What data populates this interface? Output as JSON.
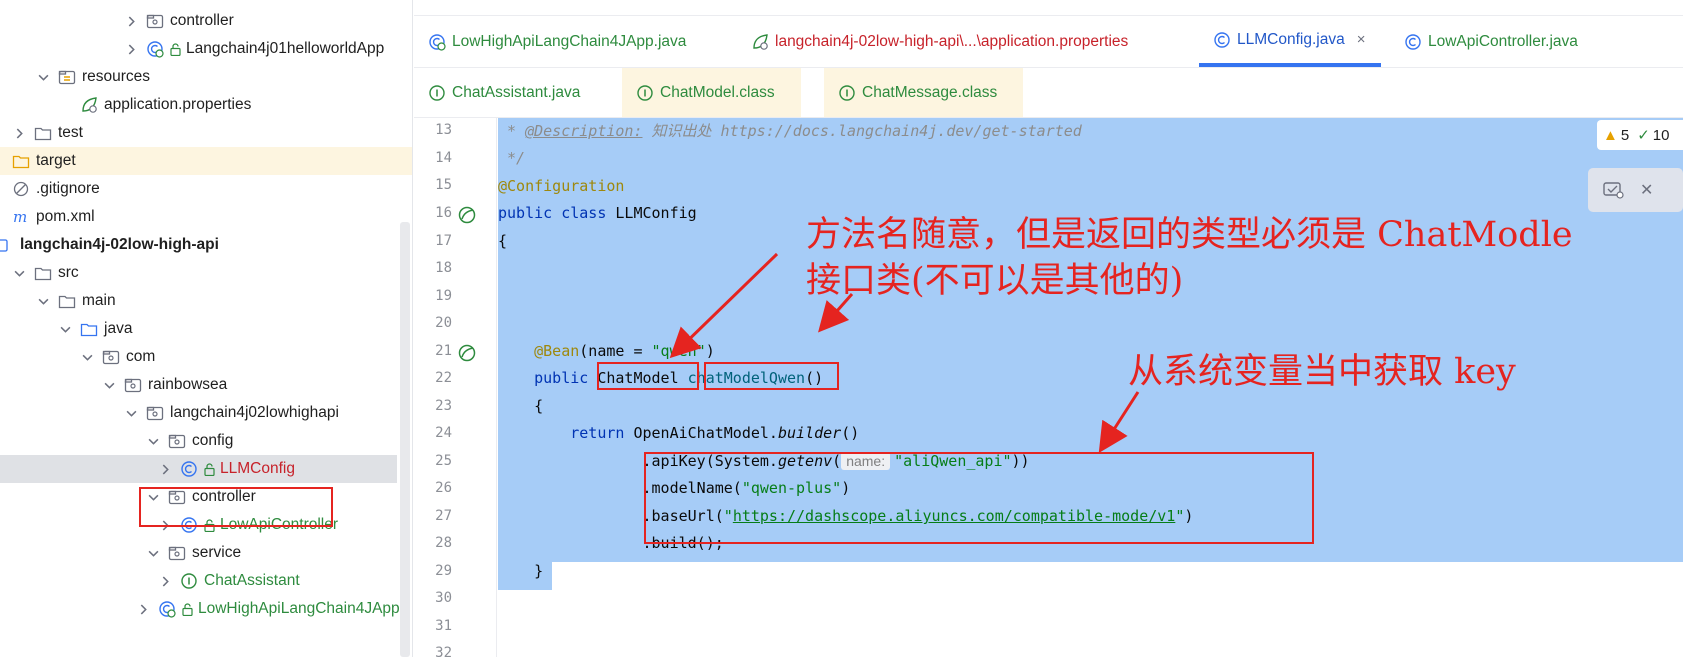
{
  "tree": {
    "items": [
      {
        "label": "controller",
        "icon": "package-folder-icon"
      },
      {
        "label": "Langchain4j01helloworldApp",
        "icon": "springboot-class-icon"
      },
      {
        "label": "resources",
        "icon": "resources-folder-icon"
      },
      {
        "label": "application.properties",
        "icon": "spring-properties-icon"
      },
      {
        "label": "test",
        "icon": "folder-icon"
      },
      {
        "label": "target",
        "icon": "excluded-folder-icon"
      },
      {
        "label": ".gitignore",
        "icon": "gitignore-icon"
      },
      {
        "label": "pom.xml",
        "icon": "maven-icon"
      },
      {
        "label": "langchain4j-02low-high-api",
        "icon": "module-icon"
      },
      {
        "label": "src",
        "icon": "folder-icon"
      },
      {
        "label": "main",
        "icon": "folder-icon"
      },
      {
        "label": "java",
        "icon": "source-folder-icon"
      },
      {
        "label": "com",
        "icon": "package-folder-icon"
      },
      {
        "label": "rainbowsea",
        "icon": "package-folder-icon"
      },
      {
        "label": "langchain4j02lowhighapi",
        "icon": "package-folder-icon"
      },
      {
        "label": "config",
        "icon": "package-folder-icon"
      },
      {
        "label": "LLMConfig",
        "icon": "class-icon"
      },
      {
        "label": "controller",
        "icon": "package-folder-icon"
      },
      {
        "label": "LowApiController",
        "icon": "class-icon"
      },
      {
        "label": "service",
        "icon": "package-folder-icon"
      },
      {
        "label": "ChatAssistant",
        "icon": "interface-icon"
      },
      {
        "label": "LowHighApiLangChain4JApp",
        "icon": "springboot-class-icon"
      }
    ]
  },
  "tabs": {
    "row1": [
      {
        "label": "LowHighApiLangChain4JApp.java",
        "icon": "springboot-class-icon"
      },
      {
        "label": "langchain4j-02low-high-api\\...\\application.properties",
        "icon": "spring-properties-icon"
      },
      {
        "label": "LLMConfig.java",
        "icon": "class-icon",
        "close": "×"
      },
      {
        "label": "LowApiController.java",
        "icon": "class-icon"
      }
    ],
    "row2": [
      {
        "label": "ChatAssistant.java",
        "icon": "interface-icon"
      },
      {
        "label": "ChatModel.class",
        "icon": "interface-icon"
      },
      {
        "label": "ChatMessage.class",
        "icon": "interface-icon"
      }
    ]
  },
  "editor": {
    "line_numbers": [
      "13",
      "14",
      "15",
      "16",
      "17",
      "18",
      "19",
      "20",
      "21",
      "22",
      "23",
      "24",
      "25",
      "26",
      "27",
      "28",
      "29",
      "30",
      "31",
      "32"
    ],
    "code": {
      "l13_a": " * ",
      "l13_tag": "@Description:",
      "l13_b": " 知识出处 https://docs.langchain4j.dev/get-started",
      "l14": " */",
      "l15": "@Configuration",
      "l16_kw": "public class",
      "l16_name": " LLMConfig",
      "l17": "{",
      "l21_ann": "    @Bean",
      "l21_a": "(name = ",
      "l21_str": "\"qwen\"",
      "l21_b": ")",
      "l22_kw": "    public",
      "l22_type": " ChatModel ",
      "l22_fn": "chatModelQwen",
      "l22_b": "()",
      "l23": "    {",
      "l24_kw": "        return",
      "l24_a": " OpenAiChatModel.",
      "l24_it": "builder",
      "l24_b": "()",
      "l25_a": "                .apiKey(System.",
      "l25_it": "getenv",
      "l25_b": "(",
      "l25_hint": "name:",
      "l25_str": "\"aliQwen_api\"",
      "l25_c": "))",
      "l26_a": "                .modelName(",
      "l26_str": "\"qwen-plus\"",
      "l26_b": ")",
      "l27_a": "                .baseUrl(",
      "l27_q1": "\"",
      "l27_url": "https://dashscope.aliyuncs.com/compatible-mode/v1",
      "l27_q2": "\"",
      "l27_b": ")",
      "l28": "                .build();",
      "l29": "    }"
    }
  },
  "inspections": {
    "warnings": "5",
    "ok": "10"
  },
  "annotations": {
    "note1_line1": "方法名随意，但是返回的类型必须是 ChatModle",
    "note1_line2": "接口类(不可以是其他的)",
    "note2": "从系统变量当中获取 key"
  },
  "colors": {
    "accent": "#3574f0",
    "selection": "#a6ccf7",
    "annotation_red": "#e52420"
  }
}
